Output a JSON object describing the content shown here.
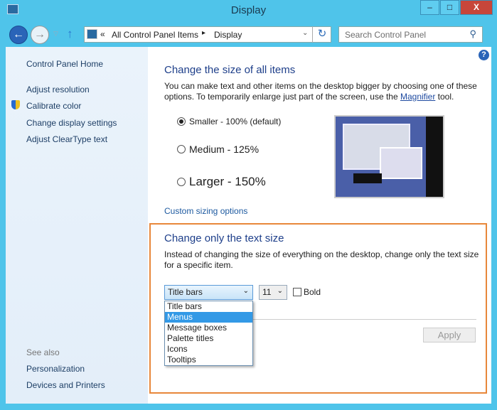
{
  "window": {
    "title": "Display",
    "minimize": "–",
    "maximize": "□",
    "close": "X"
  },
  "nav": {
    "back": "←",
    "forward": "→",
    "up": "↑",
    "crumbs_prefix": "«",
    "crumb1": "All Control Panel Items",
    "sep": "▸",
    "crumb2": "Display",
    "refresh": "↻",
    "search_placeholder": "Search Control Panel"
  },
  "sidebar": {
    "home": "Control Panel Home",
    "items": [
      "Adjust resolution",
      "Calibrate color",
      "Change display settings",
      "Adjust ClearType text"
    ],
    "see_also": "See also",
    "see_also_items": [
      "Personalization",
      "Devices and Printers"
    ]
  },
  "main": {
    "help": "?",
    "size_heading": "Change the size of all items",
    "size_desc_1": "You can make text and other items on the desktop bigger by choosing one of these",
    "size_desc_2": "options. To temporarily enlarge just part of the screen, use the ",
    "magnifier": "Magnifier",
    "size_desc_3": " tool.",
    "options": [
      "Smaller - 100% (default)",
      "Medium - 125%",
      "Larger - 150%"
    ],
    "selected_option": 0,
    "custom": "Custom sizing options",
    "text_heading": "Change only the text size",
    "text_desc_1": "Instead of changing the size of everything on the desktop, change only the text size",
    "text_desc_2": "for a specific item.",
    "item_select": "Title bars",
    "size_select": "11",
    "bold": "Bold",
    "item_options": [
      "Title bars",
      "Menus",
      "Message boxes",
      "Palette titles",
      "Icons",
      "Tooltips"
    ],
    "highlighted": "Menus",
    "apply": "Apply"
  }
}
